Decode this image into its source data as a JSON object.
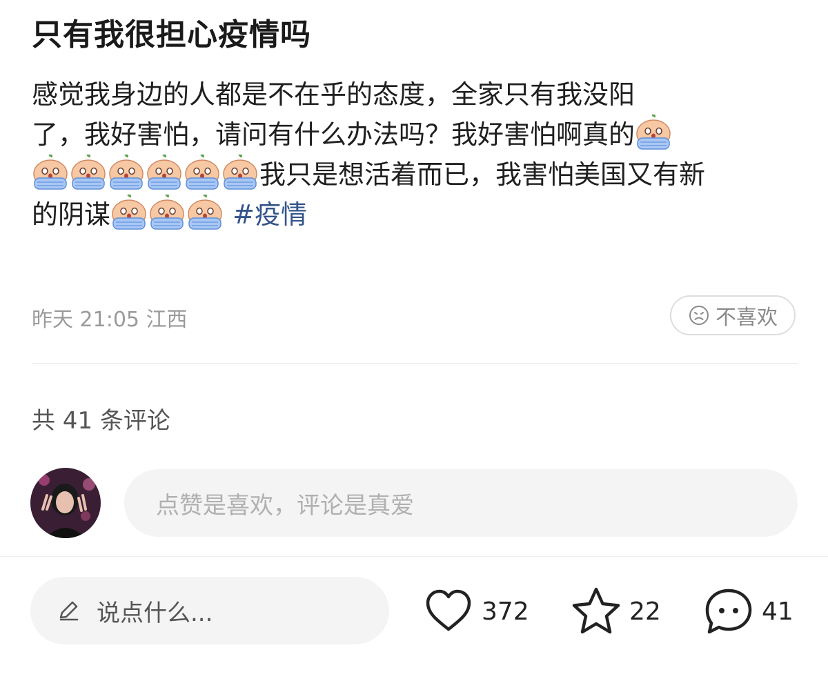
{
  "post": {
    "title": "只有我很担心疫情吗",
    "text_line1": "感觉我身边的人都是不在乎的态度，全家只有我没阳",
    "text_line2": "了，我好害怕，请问有什么办法吗？我好害怕啊真的",
    "text_line3": "我只是想活着而已，我害怕美国又有新",
    "text_line4": "的阴谋",
    "hashtag": "#疫情",
    "emoji_name": "crying-peach-emoji",
    "date": "昨天",
    "time": "21:05",
    "location": "江西",
    "dislike_label": "不喜欢"
  },
  "comments": {
    "count_label": "共 41 条评论",
    "input_placeholder": "点赞是喜欢，评论是真爱"
  },
  "bottom_bar": {
    "say_placeholder": "说点什么...",
    "likes": "372",
    "favorites": "22",
    "comments": "41"
  },
  "colors": {
    "hashtag": "#34548a",
    "meta_text": "#9a9a9a",
    "input_bg": "#f4f4f4"
  }
}
